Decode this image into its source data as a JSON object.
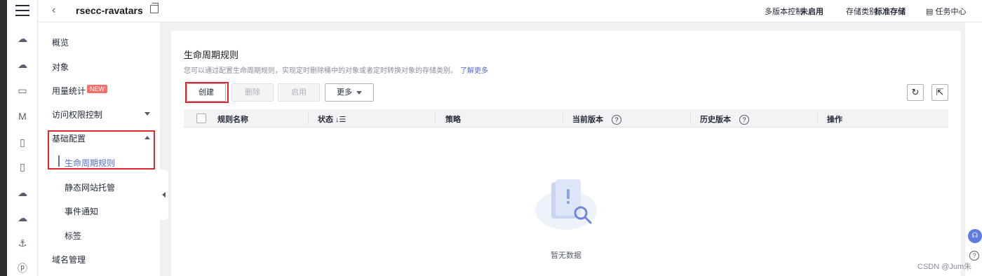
{
  "topbar": {
    "bucket_name": "rsecc-ravatars",
    "versioning_label": "多版本控制",
    "versioning_value": "未启用",
    "storage_class_label": "存储类别",
    "storage_class_value": "标准存储",
    "task_center": "任务中心"
  },
  "sidebar": {
    "overview": "概览",
    "objects": "对象",
    "usage_stats": "用量统计",
    "new_badge": "NEW",
    "access_control": "访问权限控制",
    "basic_config": "基础配置",
    "sub_items": [
      "生命周期规则",
      "静态网站托管",
      "事件通知",
      "标签"
    ],
    "domain_mgmt": "域名管理"
  },
  "main": {
    "title": "生命周期规则",
    "description": "您可以通过配置生命周期规则，实现定时删除桶中的对象或者定时转换对象的存储类别。",
    "learn_more": "了解更多",
    "buttons": {
      "create": "创建",
      "delete": "删除",
      "enable": "启用",
      "more": "更多"
    },
    "columns": [
      "规则名称",
      "状态",
      "策略",
      "当前版本",
      "历史版本",
      "操作"
    ],
    "empty_text": "暂无数据"
  },
  "watermark": "CSDN @Jum朱"
}
